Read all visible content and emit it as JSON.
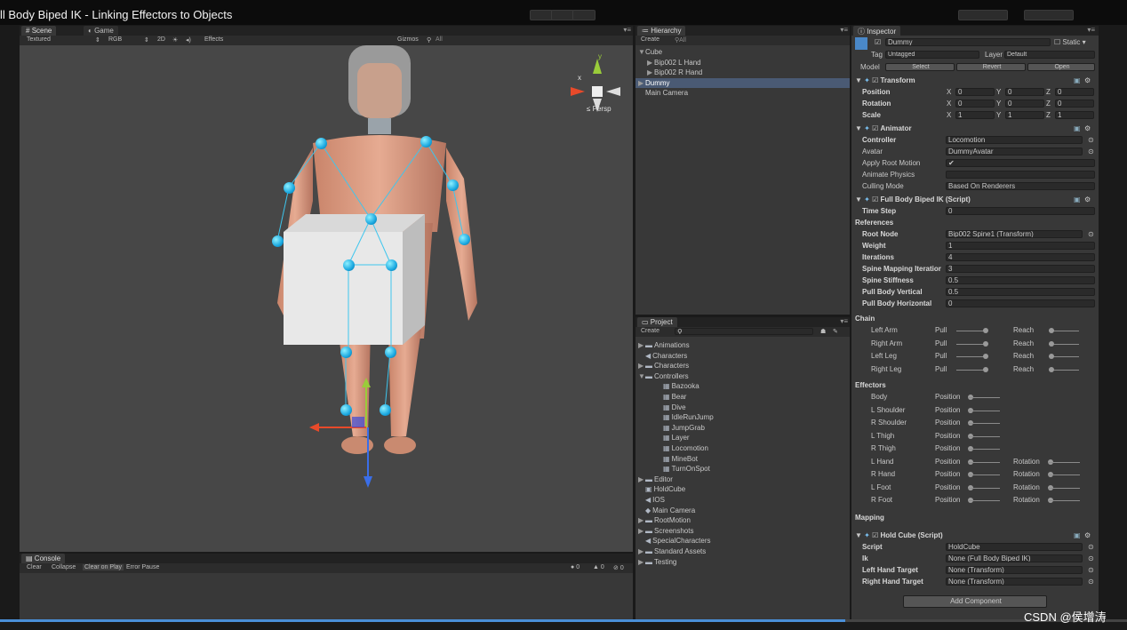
{
  "video_title": "ll Body Biped IK - Linking Effectors to Objects",
  "watermark": "CSDN @侯增涛",
  "playback_progress": 0.75,
  "scene": {
    "tabs": [
      "Scene",
      "Game"
    ],
    "toolbar": {
      "shading": "Textured",
      "render_mode": "RGB",
      "mode_2d": "2D",
      "effects": "Effects",
      "gizmos": "Gizmos",
      "search": "All"
    },
    "gizmo": {
      "x": "x",
      "y": "y",
      "persp": "Persp"
    }
  },
  "console": {
    "tab": "Console",
    "buttons": [
      "Clear",
      "Collapse",
      "Clear on Play",
      "Error Pause"
    ],
    "counts": [
      "0",
      "0",
      "0"
    ]
  },
  "hierarchy": {
    "tab": "Hierarchy",
    "create": "Create",
    "search": "All",
    "items": [
      {
        "label": "Cube",
        "indent": 0,
        "arrow": "▼"
      },
      {
        "label": "Bip002 L Hand",
        "indent": 1,
        "arrow": "▶"
      },
      {
        "label": "Bip002 R Hand",
        "indent": 1,
        "arrow": "▶"
      },
      {
        "label": "Dummy",
        "indent": 0,
        "arrow": "▶",
        "selected": true
      },
      {
        "label": "Main Camera",
        "indent": 0,
        "arrow": ""
      }
    ]
  },
  "project": {
    "tab": "Project",
    "create": "Create",
    "items": [
      {
        "label": "Animations",
        "indent": 0,
        "arrow": "▶",
        "icon": "folder"
      },
      {
        "label": "Characters",
        "indent": 0,
        "arrow": "",
        "icon": "unity"
      },
      {
        "label": "Characters",
        "indent": 0,
        "arrow": "▶",
        "icon": "folder"
      },
      {
        "label": "Controllers",
        "indent": 0,
        "arrow": "▼",
        "icon": "folder"
      },
      {
        "label": "Bazooka",
        "indent": 1,
        "arrow": "",
        "icon": "controller"
      },
      {
        "label": "Bear",
        "indent": 1,
        "arrow": "",
        "icon": "controller"
      },
      {
        "label": "Dive",
        "indent": 1,
        "arrow": "",
        "icon": "controller"
      },
      {
        "label": "IdleRunJump",
        "indent": 1,
        "arrow": "",
        "icon": "controller"
      },
      {
        "label": "JumpGrab",
        "indent": 1,
        "arrow": "",
        "icon": "controller"
      },
      {
        "label": "Layer",
        "indent": 1,
        "arrow": "",
        "icon": "controller"
      },
      {
        "label": "Locomotion",
        "indent": 1,
        "arrow": "",
        "icon": "controller"
      },
      {
        "label": "MineBot",
        "indent": 1,
        "arrow": "",
        "icon": "controller"
      },
      {
        "label": "TurnOnSpot",
        "indent": 1,
        "arrow": "",
        "icon": "controller"
      },
      {
        "label": "Editor",
        "indent": 0,
        "arrow": "▶",
        "icon": "folder"
      },
      {
        "label": "HoldCube",
        "indent": 0,
        "arrow": "",
        "icon": "script"
      },
      {
        "label": "IOS",
        "indent": 0,
        "arrow": "",
        "icon": "unity"
      },
      {
        "label": "Main Camera",
        "indent": 0,
        "arrow": "",
        "icon": "prefab"
      },
      {
        "label": "RootMotion",
        "indent": 0,
        "arrow": "▶",
        "icon": "folder"
      },
      {
        "label": "Screenshots",
        "indent": 0,
        "arrow": "▶",
        "icon": "folder"
      },
      {
        "label": "SpecialCharacters",
        "indent": 0,
        "arrow": "",
        "icon": "unity"
      },
      {
        "label": "Standard Assets",
        "indent": 0,
        "arrow": "▶",
        "icon": "folder"
      },
      {
        "label": "Testing",
        "indent": 0,
        "arrow": "▶",
        "icon": "folder"
      }
    ]
  },
  "inspector": {
    "tab": "Inspector",
    "object_name": "Dummy",
    "static_label": "Static",
    "tag_label": "Tag",
    "tag_value": "Untagged",
    "layer_label": "Layer",
    "layer_value": "Default",
    "model_label": "Model",
    "model_buttons": [
      "Select",
      "Revert",
      "Open"
    ],
    "transform": {
      "title": "Transform",
      "rows": [
        {
          "label": "Position",
          "x": "0",
          "y": "0",
          "z": "0"
        },
        {
          "label": "Rotation",
          "x": "0",
          "y": "0",
          "z": "0"
        },
        {
          "label": "Scale",
          "x": "1",
          "y": "1",
          "z": "1"
        }
      ]
    },
    "animator": {
      "title": "Animator",
      "rows": [
        {
          "label": "Controller",
          "value": "Locomotion"
        },
        {
          "label": "Avatar",
          "value": "DummyAvatar"
        },
        {
          "label": "Apply Root Motion",
          "value": "✔"
        },
        {
          "label": "Animate Physics",
          "value": ""
        },
        {
          "label": "Culling Mode",
          "value": "Based On Renderers"
        }
      ]
    },
    "fbbik": {
      "title": "Full Body Biped IK (Script)",
      "time_step": {
        "label": "Time Step",
        "value": "0"
      },
      "references": "References",
      "rows": [
        {
          "label": "Root Node",
          "value": "Bip002 Spine1 (Transform)"
        },
        {
          "label": "Weight",
          "value": "1"
        },
        {
          "label": "Iterations",
          "value": "4"
        },
        {
          "label": "Spine Mapping Iteratior",
          "value": "3"
        },
        {
          "label": "Spine Stiffness",
          "value": "0.5"
        },
        {
          "label": "Pull Body Vertical",
          "value": "0.5"
        },
        {
          "label": "Pull Body Horizontal",
          "value": "0"
        }
      ],
      "chain_title": "Chain",
      "chain": [
        {
          "label": "Left Arm",
          "pull": "Pull",
          "reach": "Reach"
        },
        {
          "label": "Right Arm",
          "pull": "Pull",
          "reach": "Reach"
        },
        {
          "label": "Left Leg",
          "pull": "Pull",
          "reach": "Reach"
        },
        {
          "label": "Right Leg",
          "pull": "Pull",
          "reach": "Reach"
        }
      ],
      "effectors_title": "Effectors",
      "effectors": [
        {
          "label": "Body",
          "position": "Position",
          "rotation": ""
        },
        {
          "label": "L Shoulder",
          "position": "Position",
          "rotation": ""
        },
        {
          "label": "R Shoulder",
          "position": "Position",
          "rotation": ""
        },
        {
          "label": "L Thigh",
          "position": "Position",
          "rotation": ""
        },
        {
          "label": "R Thigh",
          "position": "Position",
          "rotation": ""
        },
        {
          "label": "L Hand",
          "position": "Position",
          "rotation": "Rotation"
        },
        {
          "label": "R Hand",
          "position": "Position",
          "rotation": "Rotation"
        },
        {
          "label": "L Foot",
          "position": "Position",
          "rotation": "Rotation"
        },
        {
          "label": "R Foot",
          "position": "Position",
          "rotation": "Rotation"
        }
      ],
      "mapping": "Mapping"
    },
    "holdcube": {
      "title": "Hold Cube (Script)",
      "rows": [
        {
          "label": "Script",
          "value": "HoldCube"
        },
        {
          "label": "Ik",
          "value": "None (Full Body Biped IK)"
        },
        {
          "label": "Left Hand Target",
          "value": "None (Transform)"
        },
        {
          "label": "Right Hand Target",
          "value": "None (Transform)"
        }
      ]
    },
    "add_component": "Add Component"
  },
  "colors": {
    "accent": "#2ab6e6",
    "selection": "#4a5a74",
    "panel": "#383838"
  }
}
